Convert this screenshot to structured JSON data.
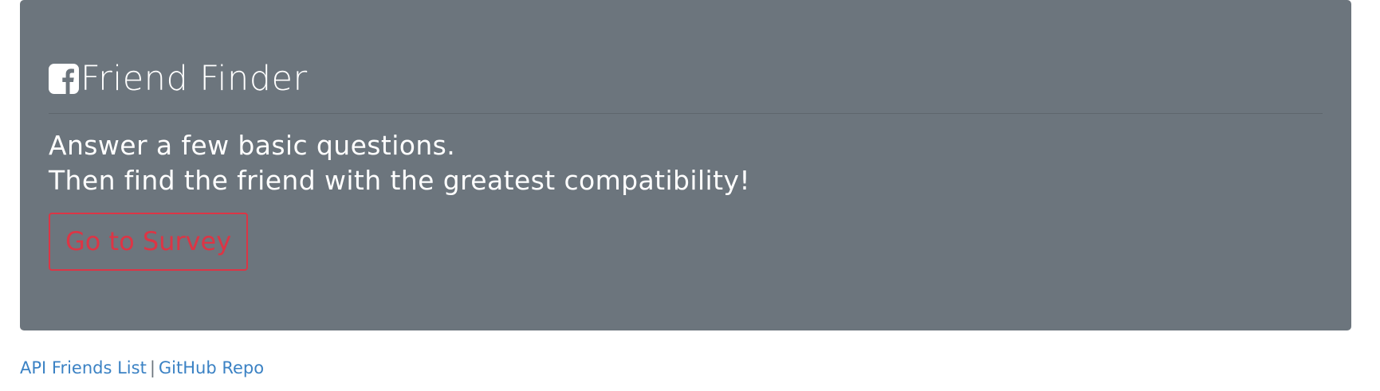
{
  "header": {
    "title": "Friend Finder",
    "icon": "facebook-square-icon"
  },
  "intro": {
    "line1": "Answer a few basic questions.",
    "line2": "Then find the friend with the greatest compatibility!"
  },
  "actions": {
    "survey_label": "Go to Survey"
  },
  "footer": {
    "api_link": "API Friends List",
    "separator": "|",
    "github_link": "GitHub Repo"
  },
  "colors": {
    "jumbotron_bg": "#6c757d",
    "button_outline": "#dc3545",
    "link": "#3b82c4",
    "text": "#ffffff"
  }
}
